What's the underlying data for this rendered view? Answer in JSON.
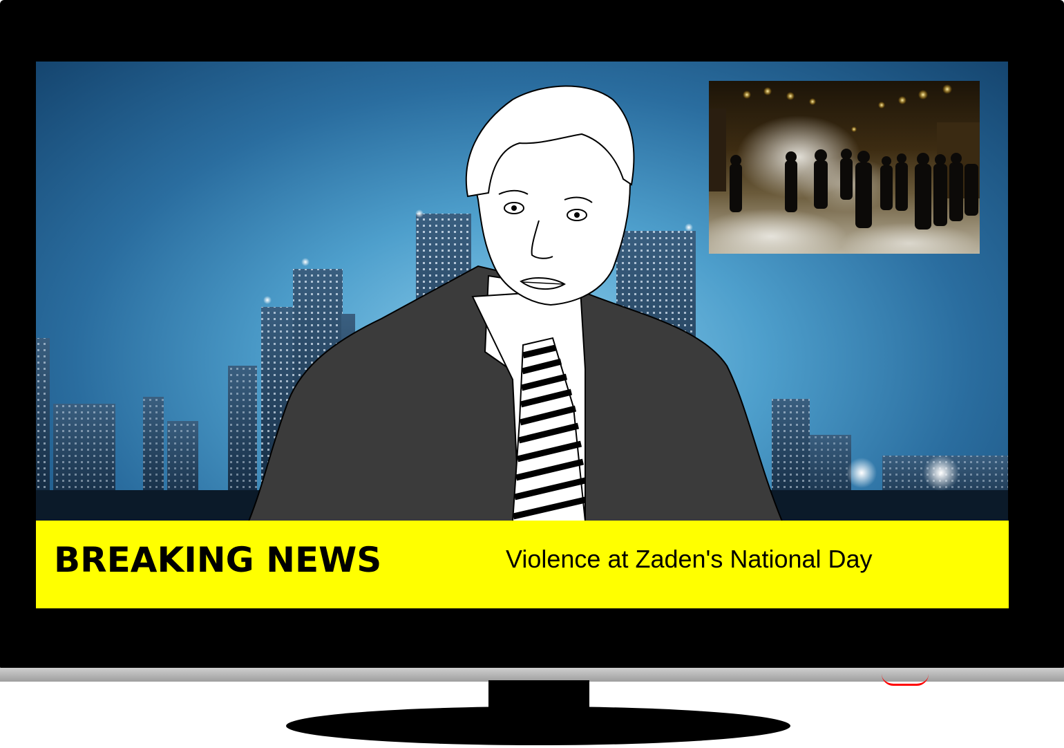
{
  "ticker": {
    "label": "BREAKING NEWS",
    "headline": "Violence at Zaden's National Day",
    "background_color": "#ffff00",
    "text_color": "#000000"
  },
  "scene": {
    "background": "night-city-skyline",
    "presenter": "news-anchor-illustration",
    "inset": "street-riot-photo"
  },
  "tv": {
    "frame_color": "#000000",
    "power_indicator_color": "#ff0000"
  }
}
